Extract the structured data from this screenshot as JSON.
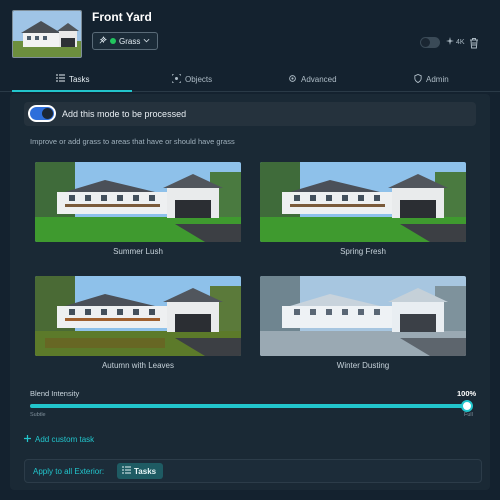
{
  "header": {
    "title": "Front Yard",
    "mode": "Grass",
    "quality": "4K",
    "thumbnail_icon": "house-photo"
  },
  "tabs": [
    {
      "label": "Tasks",
      "icon": "list-icon",
      "active": true
    },
    {
      "label": "Objects",
      "icon": "target-icon",
      "active": false
    },
    {
      "label": "Advanced",
      "icon": "gear-icon",
      "active": false
    },
    {
      "label": "Admin",
      "icon": "shield-icon",
      "active": false
    }
  ],
  "panel": {
    "enable_label": "Add this mode to be processed",
    "enabled": true,
    "description": "Improve or add grass to areas that have or should have grass",
    "options": [
      {
        "label": "Summer Lush",
        "season": "summer"
      },
      {
        "label": "Spring Fresh",
        "season": "spring"
      },
      {
        "label": "Autumn with Leaves",
        "season": "autumn"
      },
      {
        "label": "Winter Dusting",
        "season": "winter"
      }
    ],
    "blend": {
      "label": "Blend Intensity",
      "value": "100%",
      "fraction": 1.0,
      "min_label": "Subtle",
      "max_label": "Full"
    },
    "add_task_label": "Add custom task",
    "apply_label": "Apply to all Exterior:",
    "apply_chip_label": "Tasks"
  },
  "colors": {
    "accent": "#22c5cc",
    "background": "#14222f",
    "panel": "#1a2935",
    "mode_dot": "#22c5cc",
    "toggle_on": "#2d6edb"
  }
}
